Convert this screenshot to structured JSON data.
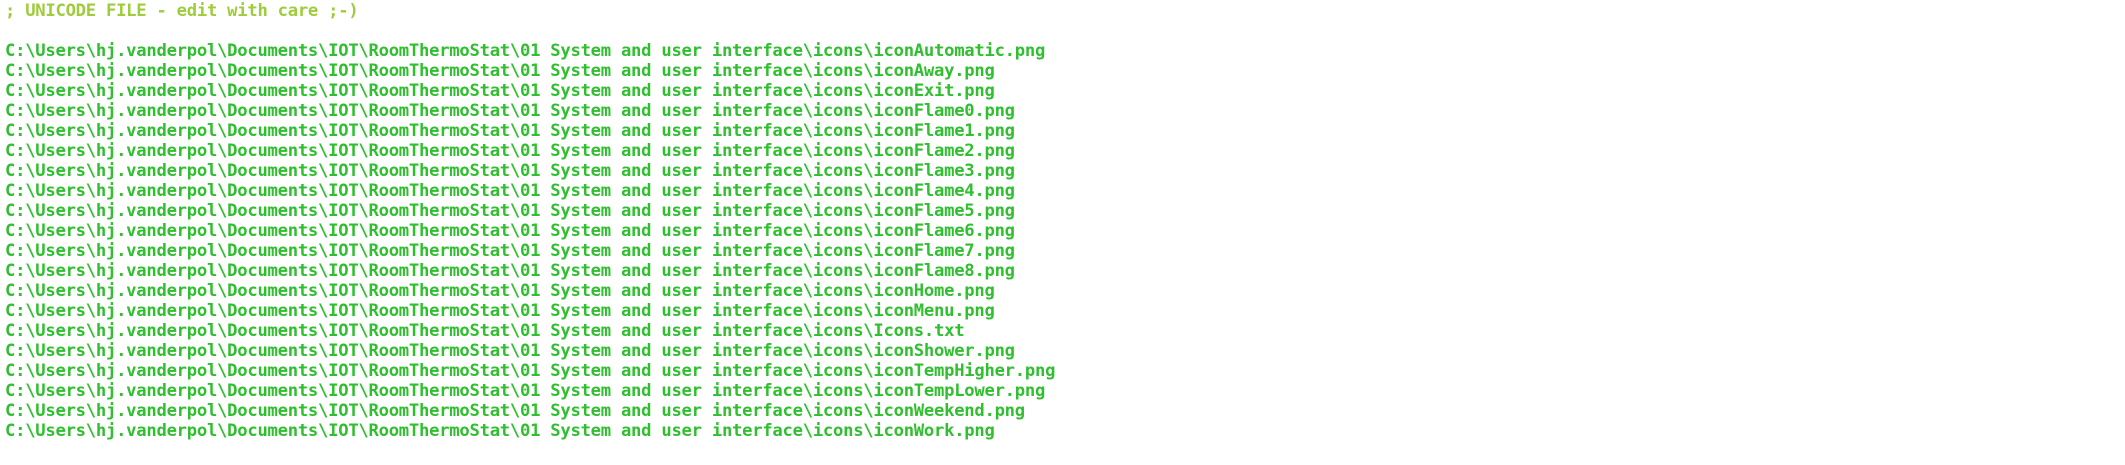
{
  "header_comment": "; UNICODE FILE - edit with care ;-)",
  "text_color": "#2fbf2f",
  "comment_color": "#9ecc3a",
  "paths": [
    "C:\\Users\\hj.vanderpol\\Documents\\IOT\\RoomThermoStat\\01 System and user interface\\icons\\iconAutomatic.png",
    "C:\\Users\\hj.vanderpol\\Documents\\IOT\\RoomThermoStat\\01 System and user interface\\icons\\iconAway.png",
    "C:\\Users\\hj.vanderpol\\Documents\\IOT\\RoomThermoStat\\01 System and user interface\\icons\\iconExit.png",
    "C:\\Users\\hj.vanderpol\\Documents\\IOT\\RoomThermoStat\\01 System and user interface\\icons\\iconFlame0.png",
    "C:\\Users\\hj.vanderpol\\Documents\\IOT\\RoomThermoStat\\01 System and user interface\\icons\\iconFlame1.png",
    "C:\\Users\\hj.vanderpol\\Documents\\IOT\\RoomThermoStat\\01 System and user interface\\icons\\iconFlame2.png",
    "C:\\Users\\hj.vanderpol\\Documents\\IOT\\RoomThermoStat\\01 System and user interface\\icons\\iconFlame3.png",
    "C:\\Users\\hj.vanderpol\\Documents\\IOT\\RoomThermoStat\\01 System and user interface\\icons\\iconFlame4.png",
    "C:\\Users\\hj.vanderpol\\Documents\\IOT\\RoomThermoStat\\01 System and user interface\\icons\\iconFlame5.png",
    "C:\\Users\\hj.vanderpol\\Documents\\IOT\\RoomThermoStat\\01 System and user interface\\icons\\iconFlame6.png",
    "C:\\Users\\hj.vanderpol\\Documents\\IOT\\RoomThermoStat\\01 System and user interface\\icons\\iconFlame7.png",
    "C:\\Users\\hj.vanderpol\\Documents\\IOT\\RoomThermoStat\\01 System and user interface\\icons\\iconFlame8.png",
    "C:\\Users\\hj.vanderpol\\Documents\\IOT\\RoomThermoStat\\01 System and user interface\\icons\\iconHome.png",
    "C:\\Users\\hj.vanderpol\\Documents\\IOT\\RoomThermoStat\\01 System and user interface\\icons\\iconMenu.png",
    "C:\\Users\\hj.vanderpol\\Documents\\IOT\\RoomThermoStat\\01 System and user interface\\icons\\Icons.txt",
    "C:\\Users\\hj.vanderpol\\Documents\\IOT\\RoomThermoStat\\01 System and user interface\\icons\\iconShower.png",
    "C:\\Users\\hj.vanderpol\\Documents\\IOT\\RoomThermoStat\\01 System and user interface\\icons\\iconTempHigher.png",
    "C:\\Users\\hj.vanderpol\\Documents\\IOT\\RoomThermoStat\\01 System and user interface\\icons\\iconTempLower.png",
    "C:\\Users\\hj.vanderpol\\Documents\\IOT\\RoomThermoStat\\01 System and user interface\\icons\\iconWeekend.png",
    "C:\\Users\\hj.vanderpol\\Documents\\IOT\\RoomThermoStat\\01 System and user interface\\icons\\iconWork.png"
  ]
}
